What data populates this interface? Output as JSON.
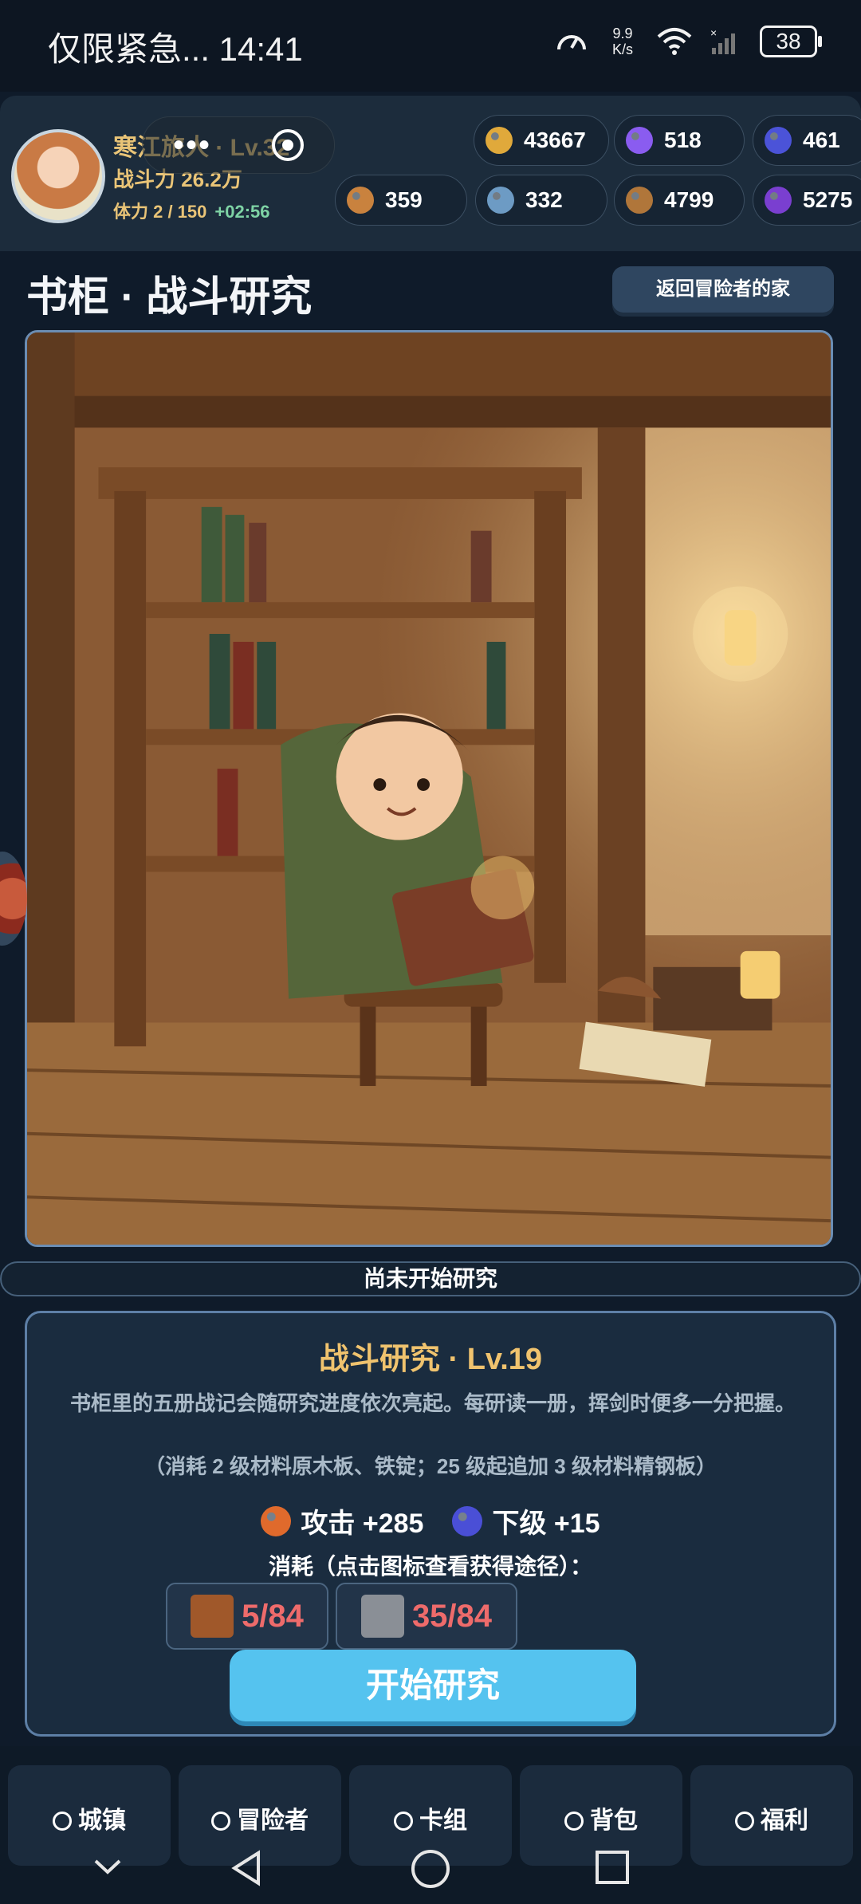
{
  "status_bar": {
    "left_text": "仅限紧急... 14:41",
    "net_speed": "9.9",
    "net_unit": "K/s",
    "battery": "38"
  },
  "player": {
    "name": "寒江旅人 · Lv.32",
    "power": "战斗力 26.2万",
    "stamina": "体力 2 / 150",
    "stamina_timer": "+02:56"
  },
  "resources": [
    {
      "icon": "gold-coin-icon",
      "color": "#e0a93b",
      "value": "43667"
    },
    {
      "icon": "purple-gem-icon",
      "color": "#8a5cf0",
      "value": "518"
    },
    {
      "icon": "blue-orb-icon",
      "color": "#4b53d8",
      "value": "461"
    },
    {
      "icon": "copper-coin-icon",
      "color": "#c9823e",
      "value": "359"
    },
    {
      "icon": "crystal-ore-icon",
      "color": "#6d9bc4",
      "value": "332"
    },
    {
      "icon": "bronze-medal-icon",
      "color": "#b0763a",
      "value": "4799"
    },
    {
      "icon": "violet-orb-icon",
      "color": "#7a3fd0",
      "value": "5275"
    }
  ],
  "page": {
    "title": "书柜 · 战斗研究",
    "back_button": "返回冒险者的家",
    "status": "尚未开始研究"
  },
  "research": {
    "title": "战斗研究 · Lv.19",
    "description": "书柜里的五册战记会随研究进度依次亮起。每研读一册，挥剑时便多一分把握。",
    "note": "（消耗 2 级材料原木板、铁锭；25 级起追加 3 级材料精钢板）",
    "bonuses": [
      {
        "icon": "attack-icon",
        "color": "#e06a2c",
        "text": "攻击 +285"
      },
      {
        "icon": "orb-icon",
        "color": "#4a4fd6",
        "text": "下级 +15"
      }
    ],
    "cost_label": "消耗（点击图标查看获得途径）：",
    "costs": [
      {
        "icon": "wood-plank-icon",
        "color": "#a0582a",
        "value": "5/84"
      },
      {
        "icon": "iron-ingot-icon",
        "color": "#8a8f96",
        "value": "35/84"
      }
    ],
    "start_button": "开始研究"
  },
  "tabs": [
    {
      "label": "城镇"
    },
    {
      "label": "冒险者"
    },
    {
      "label": "卡组"
    },
    {
      "label": "背包"
    },
    {
      "label": "福利"
    }
  ]
}
